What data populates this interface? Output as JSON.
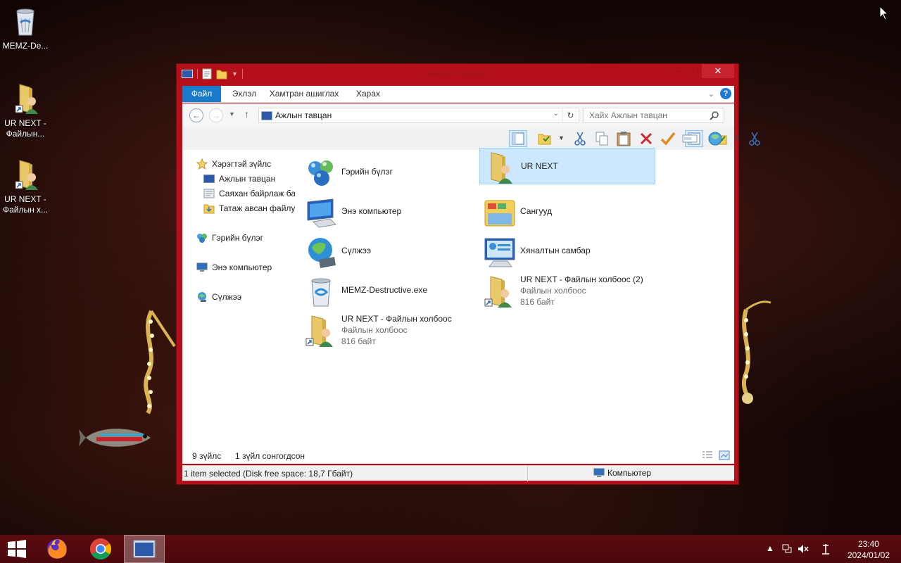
{
  "desktop": {
    "icons": [
      {
        "label": "MEMZ-De..."
      },
      {
        "label": "UR NEXT -\nФайлын..."
      },
      {
        "label": "UR NEXT -\nФайлын х..."
      }
    ]
  },
  "window": {
    "title": "Ажлын тавцан",
    "ribbon_tabs": [
      "Файл",
      "Эхлэл",
      "Хамтран ашиглах",
      "Харах"
    ],
    "address": "Ажлын тавцан",
    "search_placeholder": "Хайх Ажлын тавцан",
    "nav_pane": [
      "Хэрэгтэй зүйлс",
      "Ажлын тавцан",
      "Саяхан байрлаж ба",
      "Татаж авсан файлу",
      "Гэрийн бүлэг",
      "Энэ компьютер",
      "Сүлжээ"
    ],
    "files": [
      {
        "name": "Гэрийн бүлэг"
      },
      {
        "name": "UR NEXT"
      },
      {
        "name": "Энэ компьютер"
      },
      {
        "name": "Сангууд"
      },
      {
        "name": "Сүлжээ"
      },
      {
        "name": "Хяналтын самбар"
      },
      {
        "name": "MEMZ-Destructive.exe"
      },
      {
        "name": "UR NEXT - Файлын холбоос (2)",
        "type": "Файлын холбоос",
        "size": "816 байт"
      },
      {
        "name": "UR NEXT - Файлын холбоос",
        "type": "Файлын холбоос",
        "size": "816 байт"
      }
    ],
    "item_count": "9 зүйлс",
    "selected_count": "1 зүйл сонгогдсон",
    "statusbar_left": "1 item selected (Disk free space: 18,7 Гбайт)",
    "statusbar_right": "Компьютер"
  },
  "taskbar": {
    "time": "23:40",
    "date": "2024/01/02"
  },
  "colors": {
    "frame": "#b5101a",
    "ribbon_file": "#1979ca",
    "selection": "#cce8ff",
    "taskbar": "#520a0e"
  }
}
